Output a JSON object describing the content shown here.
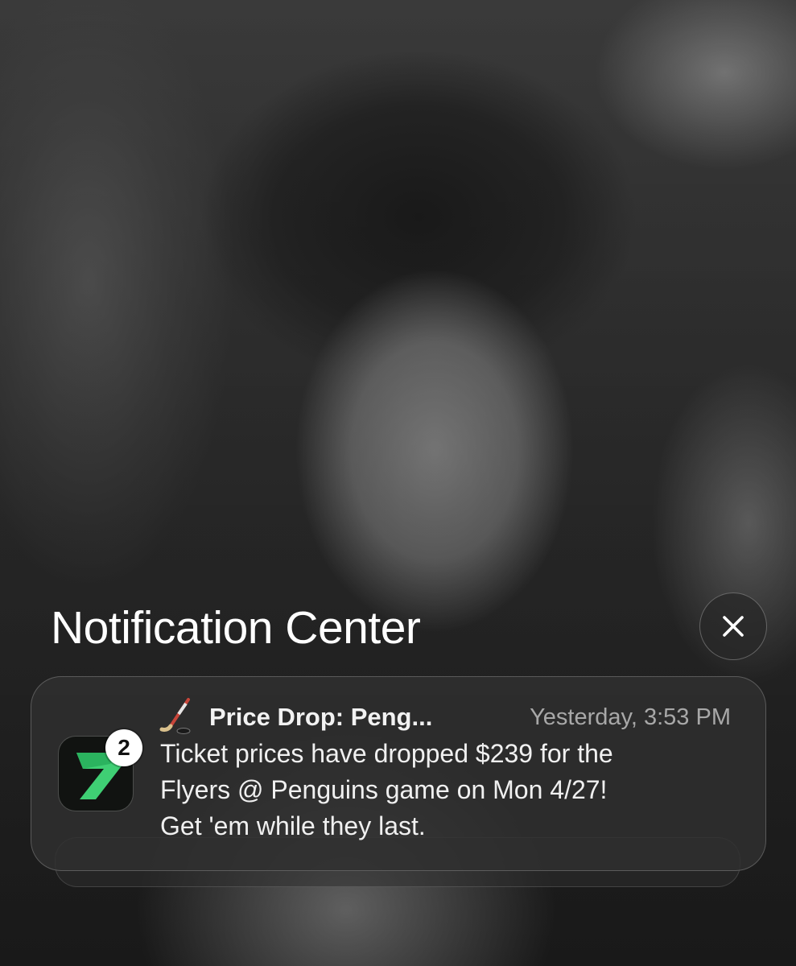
{
  "header": {
    "title": "Notification Center",
    "close_icon": "close-icon"
  },
  "notification": {
    "app_icon": "ticket-app-icon",
    "badge_count": "2",
    "emoji": "ice-hockey-emoji",
    "title": "Price Drop: Peng...",
    "timestamp": "Yesterday, 3:53 PM",
    "body_lines": [
      "Ticket prices have dropped $239 for the",
      "Flyers @ Penguins game on Mon 4/27!",
      "Get 'em while they last."
    ]
  },
  "colors": {
    "app_icon_green": "#3fcf74",
    "app_icon_bg": "#111311",
    "card_bg": "#303030"
  }
}
